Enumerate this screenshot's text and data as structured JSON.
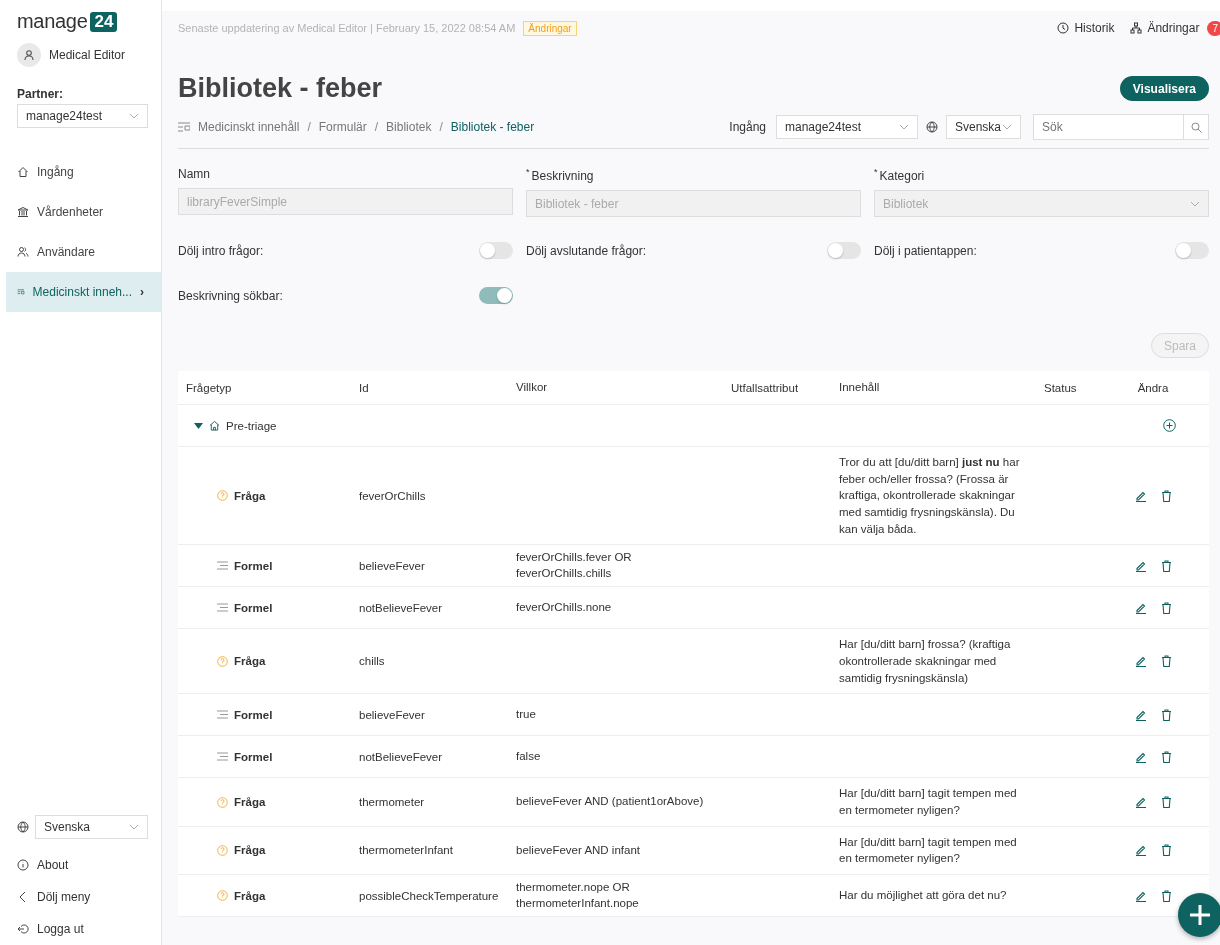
{
  "logo": {
    "text": "manage",
    "badge": "24"
  },
  "user": {
    "name": "Medical Editor"
  },
  "partner": {
    "label": "Partner:",
    "value": "manage24test"
  },
  "nav": [
    {
      "label": "Ingång",
      "selected": false
    },
    {
      "label": "Vårdenheter",
      "selected": false
    },
    {
      "label": "Användare",
      "selected": false
    },
    {
      "label": "Medicinskt inneh...",
      "selected": true,
      "arrow": "›"
    }
  ],
  "sidebar_bottom": {
    "language": "Svenska",
    "items": [
      {
        "label": "About"
      },
      {
        "label": "Dölj meny"
      },
      {
        "label": "Logga ut"
      }
    ]
  },
  "topbar": {
    "update_text": "Senaste uppdatering av Medical Editor | February 15, 2022 08:54 AM",
    "changes_tag": "Ändringar",
    "history": "Historik",
    "changes": "Ändringar",
    "changes_count": "7"
  },
  "title": "Bibliotek - feber",
  "visualize_button": "Visualisera",
  "breadcrumb_separator": "/",
  "breadcrumb": [
    {
      "label": "Medicinskt innehåll",
      "selected": false
    },
    {
      "label": "Formulär",
      "selected": false
    },
    {
      "label": "Bibliotek",
      "selected": false
    },
    {
      "label": "Bibliotek - feber",
      "selected": true
    }
  ],
  "filters": {
    "entry_label": "Ingång",
    "entry_value": "manage24test",
    "language": "Svenska",
    "search_placeholder": "Sök"
  },
  "required_mark": "*",
  "fields": [
    {
      "label": "Namn",
      "required": false,
      "value": "libraryFeverSimple",
      "kind": "text",
      "disabled": true
    },
    {
      "label": "Beskrivning",
      "required": true,
      "value": "Bibliotek - feber",
      "kind": "text",
      "disabled": true
    },
    {
      "label": "Kategori",
      "required": true,
      "value": "Bibliotek",
      "kind": "select",
      "disabled": true
    }
  ],
  "toggles": [
    {
      "label": "Dölj intro frågor:",
      "on": false
    },
    {
      "label": "Dölj avslutande frågor:",
      "on": false
    },
    {
      "label": "Dölj i patientappen:",
      "on": false
    },
    {
      "label": "Beskrivning sökbar:",
      "on": true
    }
  ],
  "save_button": {
    "label": "Spara",
    "disabled": true
  },
  "table": {
    "columns": [
      "Frågetyp",
      "Id",
      "Villkor",
      "Utfallsattribut",
      "Innehåll",
      "Status",
      "Ändra"
    ],
    "group": {
      "label": "Pre-triage",
      "expanded": true
    },
    "rows": [
      {
        "kind": "question",
        "type": "Fråga",
        "id": "feverOrChills",
        "condition": [],
        "content": "Tror du att [du/ditt barn] **just nu** har feber och/eller frossa? (Frossa är kraftiga, okontrollerade skakningar med samtidig frysningskänsla). Du kan välja båda."
      },
      {
        "kind": "formula",
        "type": "Formel",
        "id": "believeFever",
        "condition": [
          "feverOrChills.fever OR",
          "feverOrChills.chills"
        ],
        "content": ""
      },
      {
        "kind": "formula",
        "type": "Formel",
        "id": "notBelieveFever",
        "condition": [
          "feverOrChills.none"
        ],
        "content": ""
      },
      {
        "kind": "question",
        "type": "Fråga",
        "id": "chills",
        "condition": [],
        "content": "Har [du/ditt barn] frossa? (kraftiga okontrollerade skakningar med samtidig frysningskänsla)"
      },
      {
        "kind": "formula",
        "type": "Formel",
        "id": "believeFever",
        "condition": [
          "true"
        ],
        "content": ""
      },
      {
        "kind": "formula",
        "type": "Formel",
        "id": "notBelieveFever",
        "condition": [
          "false"
        ],
        "content": ""
      },
      {
        "kind": "question",
        "type": "Fråga",
        "id": "thermometer",
        "condition": [
          "believeFever AND (patient1orAbove)"
        ],
        "content": "Har [du/ditt barn] tagit tempen med en termometer nyligen?"
      },
      {
        "kind": "question",
        "type": "Fråga",
        "id": "thermometerInfant",
        "condition": [
          "believeFever AND infant"
        ],
        "content": "Har [du/ditt barn] tagit tempen med en termometer nyligen?"
      },
      {
        "kind": "question",
        "type": "Fråga",
        "id": "possibleCheckTemperature",
        "condition": [
          "thermometer.nope OR",
          "thermometerInfant.nope"
        ],
        "content": "Har du möjlighet att göra det nu?"
      }
    ]
  }
}
